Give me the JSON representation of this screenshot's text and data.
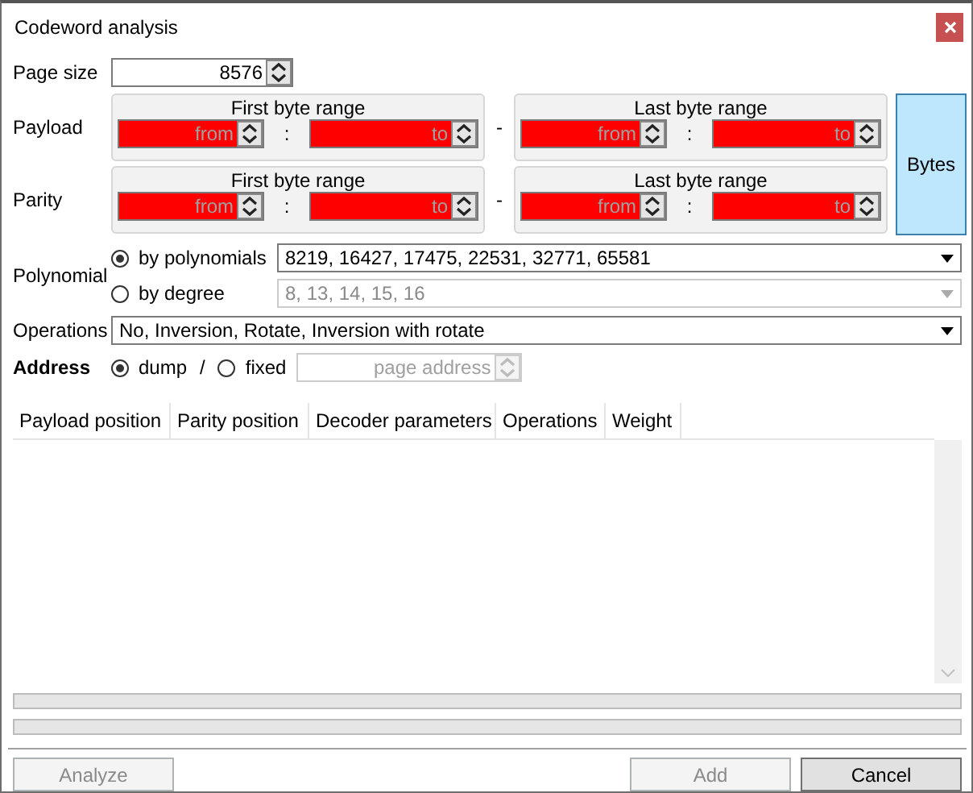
{
  "window": {
    "title": "Codeword analysis"
  },
  "page_size": {
    "label": "Page size",
    "value": "8576"
  },
  "ranges": [
    {
      "label": "Payload",
      "dash": "-",
      "groups": [
        {
          "title": "First byte range",
          "separator": ":",
          "from": {
            "placeholder": "from",
            "invalid": true
          },
          "to": {
            "placeholder": "to",
            "invalid": true
          }
        },
        {
          "title": "Last byte range",
          "separator": ":",
          "from": {
            "placeholder": "from",
            "invalid": true
          },
          "to": {
            "placeholder": "to",
            "invalid": true
          }
        }
      ]
    },
    {
      "label": "Parity",
      "dash": "-",
      "groups": [
        {
          "title": "First byte range",
          "separator": ":",
          "from": {
            "placeholder": "from",
            "invalid": true
          },
          "to": {
            "placeholder": "to",
            "invalid": true
          }
        },
        {
          "title": "Last byte range",
          "separator": ":",
          "from": {
            "placeholder": "from",
            "invalid": true
          },
          "to": {
            "placeholder": "to",
            "invalid": true
          }
        }
      ]
    }
  ],
  "bytes_button": {
    "label": "Bytes"
  },
  "polynomial": {
    "label": "Polynomial",
    "options": [
      {
        "label": "by polynomials",
        "selected": true,
        "value": "8219, 16427, 17475, 22531, 32771, 65581",
        "disabled": false
      },
      {
        "label": "by degree",
        "selected": false,
        "value": "8, 13, 14, 15, 16",
        "disabled": true
      }
    ]
  },
  "operations": {
    "label": "Operations",
    "value": "No, Inversion, Rotate, Inversion with rotate"
  },
  "address": {
    "label": "Address",
    "separator": "/",
    "options": [
      {
        "label": "dump",
        "selected": true
      },
      {
        "label": "fixed",
        "selected": false
      }
    ],
    "field": {
      "placeholder": "page address",
      "disabled": true
    }
  },
  "table": {
    "columns": [
      "Payload position",
      "Parity position",
      "Decoder parameters",
      "Operations",
      "Weight"
    ]
  },
  "progress_bars": [
    {
      "level": 0
    },
    {
      "level": 0
    }
  ],
  "buttons": [
    {
      "label": "Analyze",
      "disabled": true
    },
    {
      "label": "Add",
      "disabled": true
    },
    {
      "label": "Cancel",
      "disabled": false
    }
  ]
}
